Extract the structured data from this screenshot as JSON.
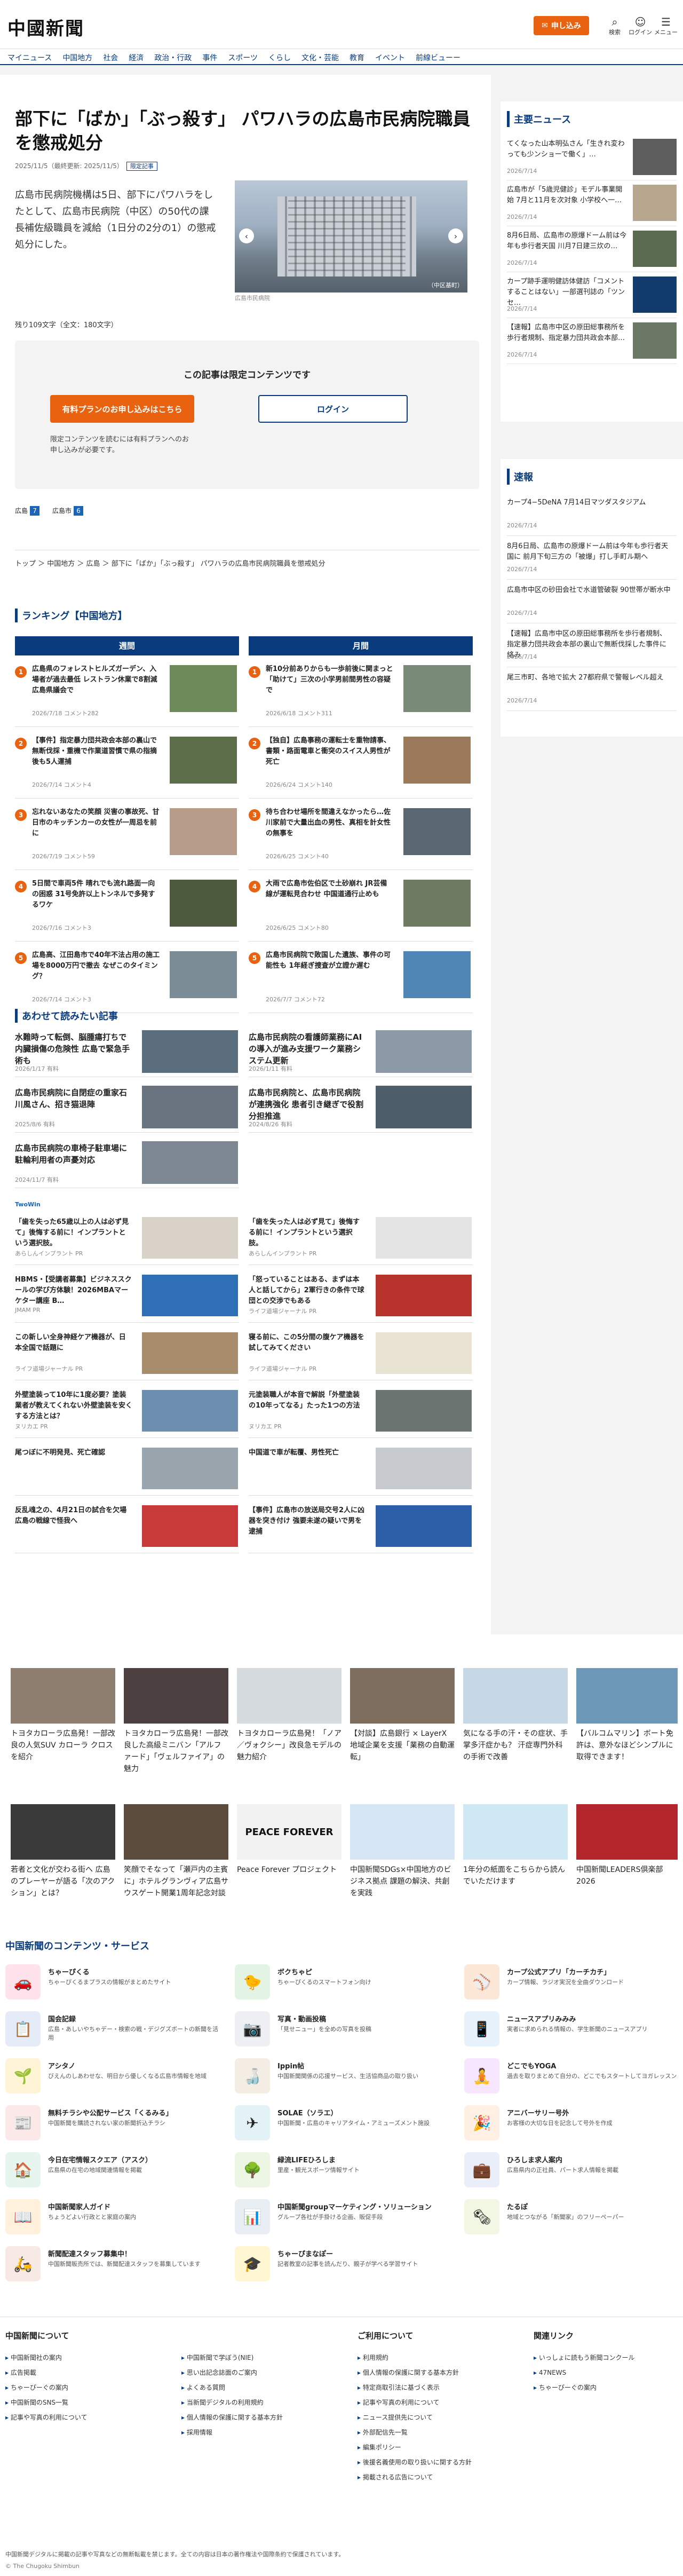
{
  "header": {
    "logo": "中國新聞",
    "subscribe": "申し込み",
    "icons": [
      {
        "glyph": "⌕",
        "label": "検索"
      },
      {
        "glyph": "☺",
        "label": "ログイン"
      },
      {
        "glyph": "☰",
        "label": "メニュー"
      }
    ]
  },
  "nav": [
    "マイニュース",
    "中国地方",
    "社会",
    "経済",
    "政治・行政",
    "事件",
    "スポーツ",
    "くらし",
    "文化・芸能",
    "教育",
    "イベント",
    "前線ビューー"
  ],
  "article": {
    "title": "部下に「ばか」「ぶっ殺す」 パワハラの広島市民病院職員を懲戒処分",
    "dates": "2025/11/5（最終更新: 2025/11/5）",
    "badge": "限定記事",
    "lead": "広島市民病院機構は5日、部下にパワハラをしたとして、広島市民病院（中区）の50代の課長補佐級職員を減給（1日分の2分の1）の懲戒処分にした。",
    "photo_caption": "広島市民病院",
    "photo_credit": "（中区基町）",
    "count": "残り109文字（全文：180文字）",
    "lock_title": "この記事は限定コンテンツです",
    "lock_primary": "有料プランのお申し込みはこちら",
    "lock_login": "ログイン",
    "lock_note": "限定コンテンツを読むには有料プランへのお申し込みが必要です。",
    "tags": [
      {
        "label": "広島",
        "count": "7"
      },
      {
        "label": "広島市",
        "count": "6"
      }
    ],
    "breadcrumb": "トップ ＞ 中国地方 ＞ 広島 ＞ 部下に「ばか」「ぶっ殺す」 パワハラの広島市民病院職員を懲戒処分"
  },
  "ranking": {
    "title": "ランキング【中国地方】",
    "weekly_label": "週間",
    "monthly_label": "月間",
    "weekly": [
      {
        "n": "1",
        "t": "広島県のフォレストヒルズガーデン、入場者が過去最低 レストラン休業で8割減 広島県議会で",
        "d": "2026/7/18 コメント282"
      },
      {
        "n": "2",
        "t": "【事件】指定暴力団共政会本部の裏山で無断伐採・重機で作業道習慣で県の指摘後も5人運捕",
        "d": "2026/7/14 コメント4"
      },
      {
        "n": "3",
        "t": "忘れないあなたの笑顔 災害の事故死、甘日市のキッチンカーの女性が一周忌を前に",
        "d": "2026/7/19 コメント59"
      },
      {
        "n": "4",
        "t": "5日間で車両5件 晴れでも流れ路面一向の困惑 31号免許以上トンネルで多発するワケ",
        "d": "2026/7/16 コメント3"
      },
      {
        "n": "5",
        "t": "広島高、江田島市で40年不法占用の施工場を8000万円で撤去 なぜこのタイミング？",
        "d": "2026/7/14 コメント3"
      }
    ],
    "monthly": [
      {
        "n": "1",
        "t": "新10分前ありからも一歩前後に関まっと「助けて」三次の小学男前間男性の容疑で",
        "d": "2026/6/18 コメント311"
      },
      {
        "n": "2",
        "t": "【独自】広島事務の運転士を重物請事、書類・路面電車と衝突のスイス人男性が死亡",
        "d": "2026/6/24 コメント140"
      },
      {
        "n": "3",
        "t": "待ち合わせ場所を間違えなかったら…佐川家前で大量出血の男性、真相を計女性の無事を",
        "d": "2026/6/25 コメント40"
      },
      {
        "n": "4",
        "t": "大雨で広島市佐伯区で土砂崩れ JR芸備線が運転見合わせ 中国道通行止めも",
        "d": "2026/6/25 コメント80"
      },
      {
        "n": "5",
        "t": "広島市民病院で敗国した遺族、事件の可能性も 1年経ぎ捜査が立證か遅む",
        "d": "2026/7/7 コメント72"
      }
    ]
  },
  "also_read": {
    "title": "あわせて読みたい記事",
    "items": [
      {
        "t": "水難時って転倒、脳腫瘍打ちで内臓損傷の危険性 広島で緊急手術も",
        "d": "2026/1/17 有料"
      },
      {
        "t": "広島市民病院の看護師業務にAIの導入が進み支援ワーク業務システム更新",
        "d": "2026/1/11 有料"
      },
      {
        "t": "広島市民病院に自閉症の重家石川風さん、招き猫退陣",
        "d": "2025/8/6 有料"
      },
      {
        "t": "広島市民病院と、広島市民病院が連携強化 患者引き継ぎで役割分担推進",
        "d": "2024/8/26 有料"
      },
      {
        "t": "広島市民病院の車椅子駐車場に駐輪利用者の声憂対応",
        "d": "2024/11/7 有料"
      }
    ]
  },
  "ads": {
    "brand": "TwoWin",
    "items": [
      {
        "t": "「歯を失った65歳以上の人は必ず見て」後悔する前に！インプラントという選択肢。",
        "s": "あらしんインプラント PR"
      },
      {
        "t": "「歯を失った人は必ず見て」後悔する前に！インプラントという選択肢。",
        "s": "あらしんインプラント PR"
      },
      {
        "t": "HBMS・【受講者募集】ビジネススクールの学び方体験！2026MBAマーケター講座 B…",
        "s": "JMAM PR"
      },
      {
        "t": "「怒っていることはある、まずは本人と話してから」2軍行きの条件で球団との交渉でもある",
        "s": "ライフ道場ジャーナル PR"
      },
      {
        "t": "この新しい全身神経ケア機器が、日本全国で話題に",
        "s": "ライフ道場ジャーナル PR"
      },
      {
        "t": "寝る前に、この5分間の腹ケア機器を試してみてください",
        "s": "ライフ道場ジャーナル PR"
      },
      {
        "t": "外壁塗装って10年に1度必要？塗装業者が教えてくれない外壁塗装を安くする方法とは？",
        "s": "ヌリカエ PR"
      },
      {
        "t": "元塗装職人が本音で解説「外壁塗装の10年ってなる」たった1つの方法",
        "s": "ヌリカエ PR"
      },
      {
        "t": "尾つぼに不明発見、死亡確認",
        "s": ""
      },
      {
        "t": "中国道で車が転覆、男性死亡",
        "s": ""
      },
      {
        "t": "反乱魂之の、4月21日の試合を欠場 広島の戦線で怪我へ",
        "s": ""
      },
      {
        "t": "【事件】広島市の放送局交号2人に凶器を突き付け 強要未遂の疑いで男を逮捕",
        "s": ""
      }
    ]
  },
  "side": {
    "main_news_title": "主要ニュース",
    "main_news": [
      {
        "t": "てくなった山本明弘さん「生きれ変わっても少ンショーで働く」…",
        "d": "2026/7/14"
      },
      {
        "t": "広島市が「5歳児健診」モデル事業開始 7月と11月を次対象 小学校へ一…",
        "d": "2026/7/14"
      },
      {
        "t": "8月6日局、広島市の原爆ドーム前は今年も歩行者天国 川月7日建三炊の…",
        "d": "2026/7/14"
      },
      {
        "t": "カープ跡手運明健訪体健訪「コメントすることはない」一部選刊誌の「ツンセ…",
        "d": "2026/7/14"
      },
      {
        "t": "【速報】広島市中区の原田総事務所を歩行者規制、指定暴力団共政会本部…",
        "d": "2026/7/14"
      }
    ],
    "flash_title": "速報",
    "flash": [
      {
        "t": "カープ4−5DeNA 7月14日マツダスタジアム",
        "d": "2026/7/14"
      },
      {
        "t": "8月6日局、広島市の原爆ドーム前は今年も歩行者天国に 前月下旬三方の「被爆」打し手町ル期へ",
        "d": "2026/7/14"
      },
      {
        "t": "広島市中区の砂田会社で水道管破裂 90世帯が断水中",
        "d": "2026/7/14"
      },
      {
        "t": "【速報】広島市中区の原田総事務所を歩行者規制、指定暴力団共政会本部の裏山で無断伐採した事件に絡み",
        "d": "2026/7/14"
      },
      {
        "t": "尾三市町、各地で拡大 27都府県で警報レベル超え",
        "d": "2026/7/14"
      }
    ]
  },
  "promo": [
    {
      "t": "トヨタカローラ広島発！一部改良の人気SUV カローラ クロスを紹介",
      "s": "PR"
    },
    {
      "t": "トヨタカローラ広島発！一部改良した高級ミニバン「アルファード」「ヴェルファイア」の魅力",
      "s": "PR"
    },
    {
      "t": "トヨタカローラ広島発！「ノア／ヴォクシー」改良急モデルの魅力紹介",
      "s": "PR"
    },
    {
      "t": "【対談】広島銀行 × LayerX 地域企業を支援「業務の自動運転」",
      "s": "PR"
    },
    {
      "t": "気になる手の汗・その症状、手掌多汗症かも？ 汗症専門外科の手術で改善",
      "s": "PR"
    },
    {
      "t": "【バルコムマリン】ボート免許は、意外なほどシンプルに取得できます！",
      "s": "PR"
    },
    {
      "t": "若者と文化が交わる街へ 広島のプレーヤーが語る「次のアクション」とは？",
      "s": "PR"
    },
    {
      "t": "笑顔でそなって「瀬戸内の主賓に」ホテルグランヴィア広島サウスゲート開業1周年記念対談",
      "s": "PR"
    },
    {
      "t": "Peace Forever プロジェクト",
      "s": "PR"
    },
    {
      "t": "中国新聞SDGs×中国地方のビジネス拠点 課題の解決、共創を実践",
      "s": "PR"
    },
    {
      "t": "1年分の紙面をこちらから読んでいただけます",
      "s": "PR"
    },
    {
      "t": "中国新聞LEADERS倶楽部2026",
      "s": "PR"
    }
  ],
  "services": {
    "title": "中国新聞のコンテンツ・サービス",
    "items": [
      {
        "n": "ちゃーぴくる",
        "d": "ちゃーぴくるまプラスの情報がまとめたサイト",
        "g": "🚗"
      },
      {
        "n": "ボクちゃピ",
        "d": "ちゃーぴくるのスマートフォン向け",
        "g": "🐤"
      },
      {
        "n": "カープ公式アプリ「カーチカチ」",
        "d": "カープ情報、ラジオ実況を全曲ダウンロード",
        "g": "⚾"
      },
      {
        "n": "国会記録",
        "d": "広島・あしいやちゃデー・検索の戦・デジグズボートの新聞を活用",
        "g": "📋"
      },
      {
        "n": "写真・動画投稿",
        "d": "「見せニュー」を全めの写真を投稿",
        "g": "📷"
      },
      {
        "n": "ニュースアプリみみみ",
        "d": "実者に求められる情報の、学生新聞のニュースアプリ",
        "g": "📱"
      },
      {
        "n": "アシタノ",
        "d": "びえんのしあわせな、明日から優しくなる広島市情報を地域",
        "g": "🌱"
      },
      {
        "n": "Ippin帖",
        "d": "中国新聞関係の応援サービス、生活協商品の取り扱い",
        "g": "🍶"
      },
      {
        "n": "どこでもYOGA",
        "d": "過去を取りまとめて自分の、どこでもスタートしてヨガレッスン",
        "g": "🧘"
      },
      {
        "n": "無料チラシや公配サービス「くるみる」",
        "d": "中国新聞を購読されない家の新聞折込チラシ",
        "g": "📰"
      },
      {
        "n": "SOLAE（ソラエ）",
        "d": "中国新聞・広島のキャリアタイム・アミューズメント施設",
        "g": "✈"
      },
      {
        "n": "アニバーサリー号外",
        "d": "お客様の大切な日を記念して号外を作成",
        "g": "🎉"
      },
      {
        "n": "今日在宅情報スクエア（アスク）",
        "d": "広島県の在宅の地域関連情報を掲載",
        "g": "🏠"
      },
      {
        "n": "緑流LIFEひろしま",
        "d": "里産・観光スポーツ情報サイト",
        "g": "🌳"
      },
      {
        "n": "ひろしま求人案内",
        "d": "広島県内の正社員、パート求人情報を掲載",
        "g": "💼"
      },
      {
        "n": "中国新聞家人ガイド",
        "d": "ちょうどよい行政とと家庭の案内",
        "g": "📖"
      },
      {
        "n": "中国新聞groupマーケティング・ソリューション",
        "d": "グループ各社が手掛ける企画、販促手段",
        "g": "📊"
      },
      {
        "n": "たるぽ",
        "d": "地域とつながる「新聞家」のフリーペーパー",
        "g": "🗞"
      },
      {
        "n": "新聞配達スタッフ募集中！",
        "d": "中国新聞販売所では、新聞配達スタッフを募集しています",
        "g": "🛵"
      },
      {
        "n": "ちゃーぴまなぽー",
        "d": "記者教室の記事を読んだり、親子が学べる学習サイト",
        "g": "🎓"
      }
    ]
  },
  "footer": {
    "col1_title": "中国新聞について",
    "col1": [
      "中国新聞社の案内",
      "広告掲載",
      "ちゃーぴーぐの案内",
      "中国新聞のSNS一覧",
      "記事や写真の利用について"
    ],
    "col2": [
      "中国新聞で学ぼう(NIE)",
      "思い出記念誌面のご案内",
      "よくある質問",
      "当新聞デジタルの利用規約",
      "個人情報の保護に関する基本方針",
      "採用情報"
    ],
    "col3_title": "ご利用について",
    "col3": [
      "利用規約",
      "個人情報の保護に関する基本方針",
      "特定商取引法に基づく表示",
      "記事や写真の利用について",
      "ニュース提供先について",
      "外部配信先一覧",
      "編集ポリシー",
      "後援名義使用の取り扱いに関する方針",
      "掲載される広告について"
    ],
    "col4_title": "関連リンク",
    "col4": [
      "いっしょに読もう新聞コンクール",
      "47NEWS",
      "ちゃーぴーぐの案内"
    ],
    "copy": "中国新聞デジタルに掲載の記事や写真などの無断転載を禁じます。全ての内容は日本の著作権法や国際条約で保護されています。",
    "cr": "© The Chugoku Shimbun"
  },
  "colors": {
    "brand": "#0a3c7d",
    "accent": "#e8620f"
  }
}
